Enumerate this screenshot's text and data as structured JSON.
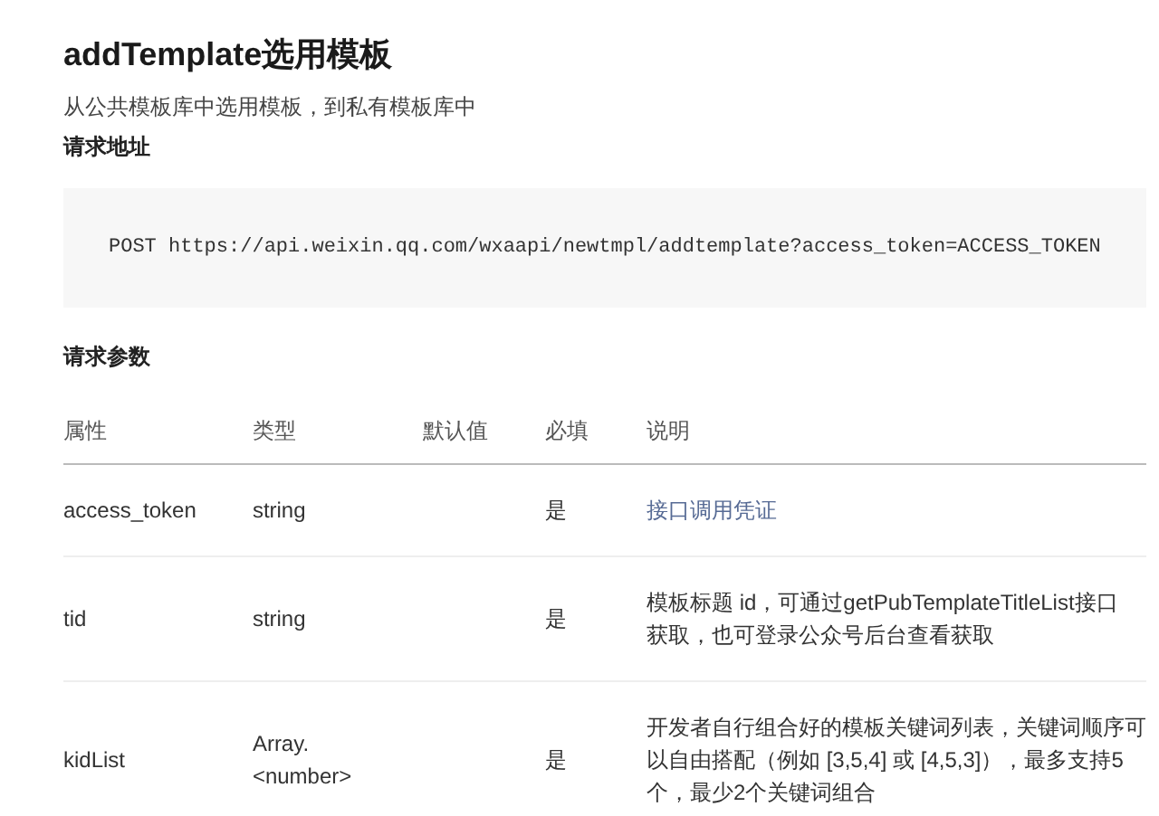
{
  "title": "addTemplate选用模板",
  "summary": "从公共模板库中选用模板，到私有模板库中",
  "request_url": {
    "heading": "请求地址",
    "code": "POST https://api.weixin.qq.com/wxaapi/newtmpl/addtemplate?access_token=ACCESS_TOKEN"
  },
  "params": {
    "heading": "请求参数",
    "columns": [
      "属性",
      "类型",
      "默认值",
      "必填",
      "说明"
    ],
    "rows": [
      {
        "name": "access_token",
        "type": [
          "string"
        ],
        "required": "是",
        "kind": "link",
        "description": [
          "接口调用凭证"
        ]
      },
      {
        "name": "tid",
        "type": [
          "string"
        ],
        "required": "是",
        "kind": "text",
        "description": [
          "模板标题 id，可通过getPubTemplateTitleList接口",
          "获取，也可登录公众号后台查看获取"
        ]
      },
      {
        "name": "kidList",
        "type": [
          "Array.",
          "<number>"
        ],
        "required": "是",
        "kind": "text",
        "description": [
          "开发者自行组合好的模板关键词列表，关键词顺序可",
          "以自由搭配（例如 [3,5,4] 或 [4,5,3]），最多支持5",
          "个，最少2个关键词组合"
        ]
      }
    ]
  }
}
